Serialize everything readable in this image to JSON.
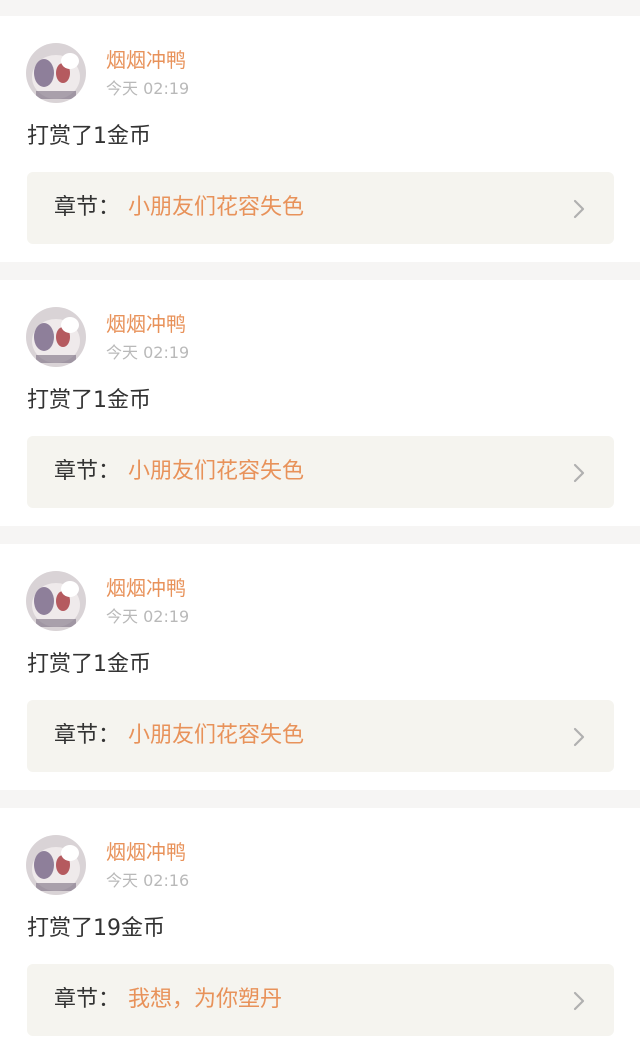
{
  "feed": {
    "items": [
      {
        "username": "烟烟冲鸭",
        "time": "今天 02:19",
        "action": "打赏了1金币",
        "chapter_label": "章节：",
        "chapter_title": "小朋友们花容失色"
      },
      {
        "username": "烟烟冲鸭",
        "time": "今天 02:19",
        "action": "打赏了1金币",
        "chapter_label": "章节：",
        "chapter_title": "小朋友们花容失色"
      },
      {
        "username": "烟烟冲鸭",
        "time": "今天 02:19",
        "action": "打赏了1金币",
        "chapter_label": "章节：",
        "chapter_title": "小朋友们花容失色"
      },
      {
        "username": "烟烟冲鸭",
        "time": "今天 02:16",
        "action": "打赏了19金币",
        "chapter_label": "章节：",
        "chapter_title": "我想，为你塑丹"
      }
    ]
  },
  "colors": {
    "accent": "#e8925a",
    "text": "#333333",
    "muted": "#b9b9b9",
    "chapter_bg": "#f5f4ef",
    "page_bg": "#f6f5f4"
  },
  "icons": {
    "chevron": "chevron-right-icon",
    "avatar": "avatar"
  }
}
